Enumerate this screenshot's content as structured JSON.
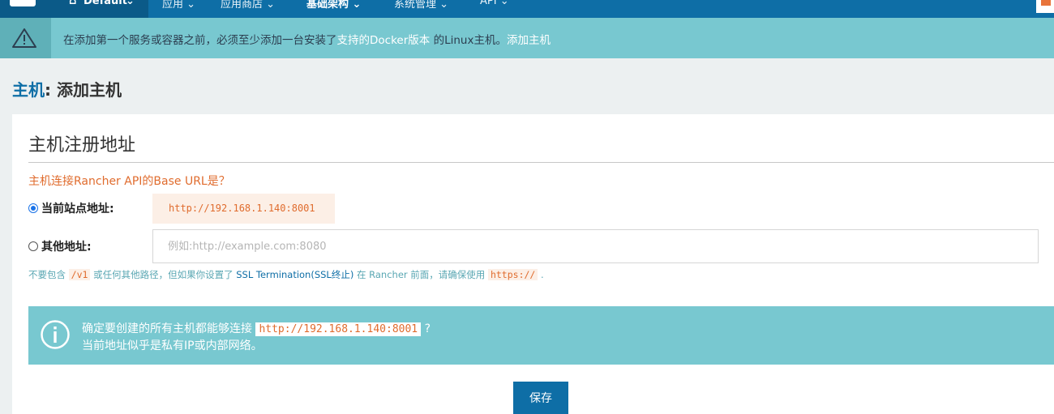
{
  "nav": {
    "environment": "Default",
    "items": [
      "应用",
      "应用商店",
      "基础架构",
      "系统管理",
      "API"
    ],
    "active_index": 2
  },
  "banner": {
    "prefix": "在添加第一个服务或容器之前，必须至少添加一台安装了",
    "link": "支持的Docker版本",
    "middle": " 的Linux主机。",
    "action": "添加主机"
  },
  "page": {
    "crumb": "主机",
    "sep": ":",
    "title": " 添加主机"
  },
  "section": {
    "title": "主机注册地址",
    "question": "主机连接Rancher API的Base URL是？"
  },
  "options": {
    "current_label": "当前站点地址:",
    "current_url": "http://192.168.1.140:8001",
    "other_label": "其他地址:",
    "other_placeholder": "例如:http://example.com:8080",
    "other_value": ""
  },
  "hint": {
    "t1": "不要包含",
    "code1": "/v1",
    "t2": "或任何其他路径，但如果你设置了",
    "t3": "SSL Termination(SSL终止)",
    "t4": "在 Rancher 前面，请确保使用",
    "code2": "https://",
    "t5": "."
  },
  "info": {
    "line1_prefix": "确定要创建的所有主机都能够连接",
    "line1_code": "http://192.168.1.140:8001",
    "line1_suffix": " ?",
    "line2": "当前地址似乎是私有IP或内部网络。"
  },
  "save_label": "保存",
  "colors": {
    "nav": "#0e6ea6",
    "banner": "#78c8d0",
    "accent_orange": "#e06c2e"
  }
}
